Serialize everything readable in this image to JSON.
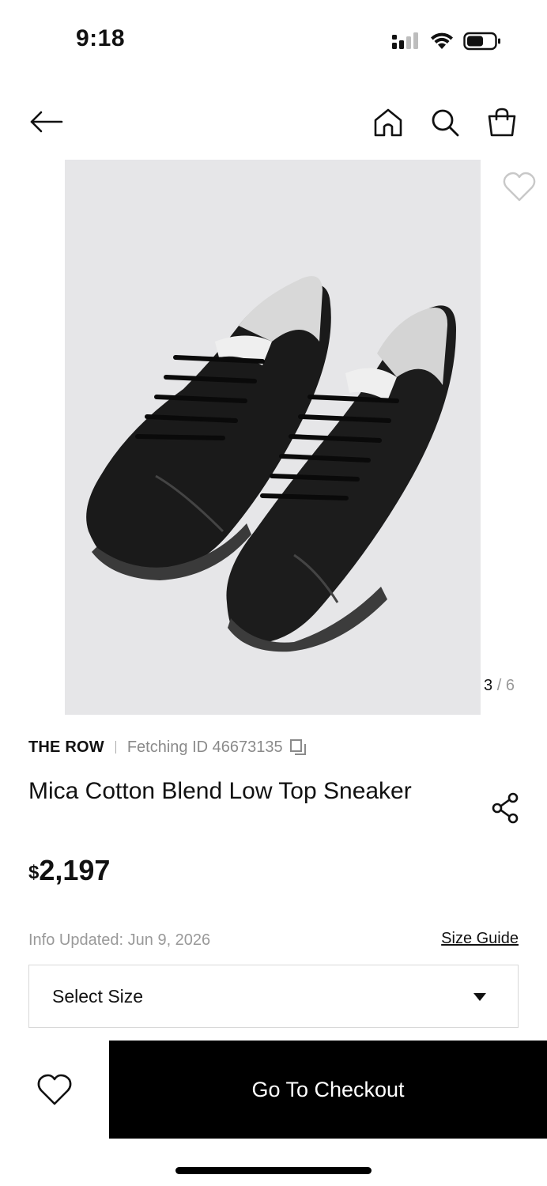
{
  "status_bar": {
    "time": "9:18"
  },
  "nav": {
    "back_icon": "arrow-left-icon",
    "home_icon": "home-icon",
    "search_icon": "search-icon",
    "bag_icon": "shopping-bag-icon"
  },
  "gallery": {
    "current": "3",
    "separator": "/",
    "total": "6",
    "image_subject": "pair of black sneakers"
  },
  "product": {
    "brand": "THE ROW",
    "fetching_id": "Fetching ID 46673135",
    "title": "Mica Cotton Blend Low Top Sneaker",
    "price_currency": "$",
    "price_amount": "2,197",
    "info_updated": "Info Updated: Jun 9, 2026",
    "size_guide": "Size Guide"
  },
  "size_selector": {
    "label": "Select Size"
  },
  "bottom": {
    "checkout_label": "Go To Checkout"
  },
  "colors": {
    "accent": "#000000",
    "muted_text": "#999999",
    "image_bg": "#e6e6e8"
  }
}
